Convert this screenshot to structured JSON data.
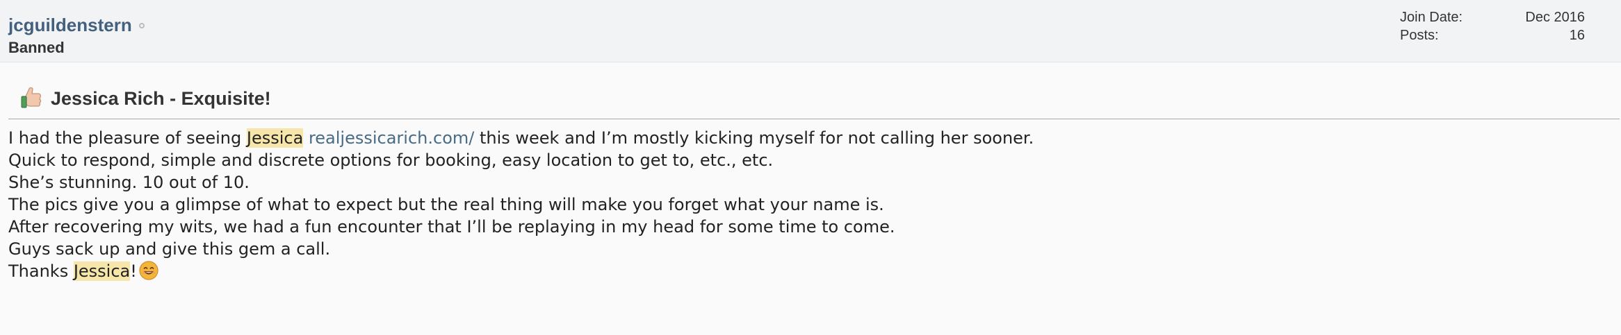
{
  "user": {
    "name": "jcguildenstern",
    "rank": "Banned",
    "stats": [
      {
        "label": "Join Date:",
        "value": "Dec 2016"
      },
      {
        "label": "Posts:",
        "value": "16"
      }
    ]
  },
  "post": {
    "title": "Jessica Rich - Exquisite!",
    "icon": "thumbs-up-icon",
    "body": {
      "line1_prefix": "I had the pleasure of seeing ",
      "line1_highlight": "Jessica",
      "line1_link": "realjessicarich.com/",
      "line1_suffix": " this week and I’m mostly kicking myself for not calling her sooner.",
      "line2": "Quick to respond, simple and discrete options for booking, easy location to get to, etc., etc.",
      "line3": "She’s stunning. 10 out of 10.",
      "line4": "The pics give you a glimpse of what to expect but the real thing will make you forget what your name is.",
      "line5": "After recovering my wits, we had a fun encounter that I’ll be replaying in my head for some time to come.",
      "line6": "Guys sack up and give this gem a call.",
      "line7_prefix": "Thanks ",
      "line7_highlight": "Jessica",
      "line7_suffix": "!",
      "emoji": "smile-emoji-icon"
    }
  },
  "colors": {
    "username": "#43607e",
    "link": "#486b86",
    "highlight": "#f7e6aa",
    "header_bg": "#f1f3f5",
    "page_bg": "#fafafa"
  }
}
